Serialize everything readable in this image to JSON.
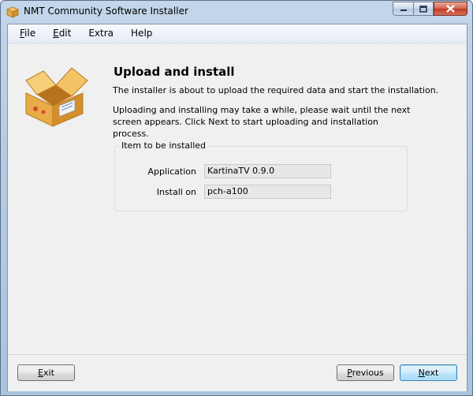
{
  "window": {
    "title": "NMT Community Software Installer",
    "controls": {
      "minimize_icon": "minimize-icon",
      "maximize_icon": "maximize-icon",
      "close_icon": "close-icon"
    }
  },
  "menu": {
    "items": [
      {
        "label": "File",
        "mnemonic": "F",
        "rest": "ile"
      },
      {
        "label": "Edit",
        "mnemonic": "E",
        "rest": "dit"
      },
      {
        "label": "Extra",
        "mnemonic": "",
        "rest": "Extra"
      },
      {
        "label": "Help",
        "mnemonic": "",
        "rest": "Help"
      }
    ]
  },
  "page": {
    "heading": "Upload and install",
    "description_1": "The installer is about to upload the required data and start the installation.",
    "description_2": "Uploading and installing may take a while, please wait until the next screen appears. Click Next to start uploading and installation process.",
    "group": {
      "title": "Item to be installed",
      "fields": [
        {
          "label": "Application",
          "value": "KartinaTV 0.9.0"
        },
        {
          "label": "Install on",
          "value": "pch-a100"
        }
      ]
    }
  },
  "buttons": {
    "exit": {
      "label": "Exit",
      "mnemonic": "E",
      "rest": "xit"
    },
    "previous": {
      "label": "Previous",
      "mnemonic": "P",
      "rest": "revious"
    },
    "next": {
      "label": "Next",
      "mnemonic": "N",
      "rest": "ext"
    }
  }
}
